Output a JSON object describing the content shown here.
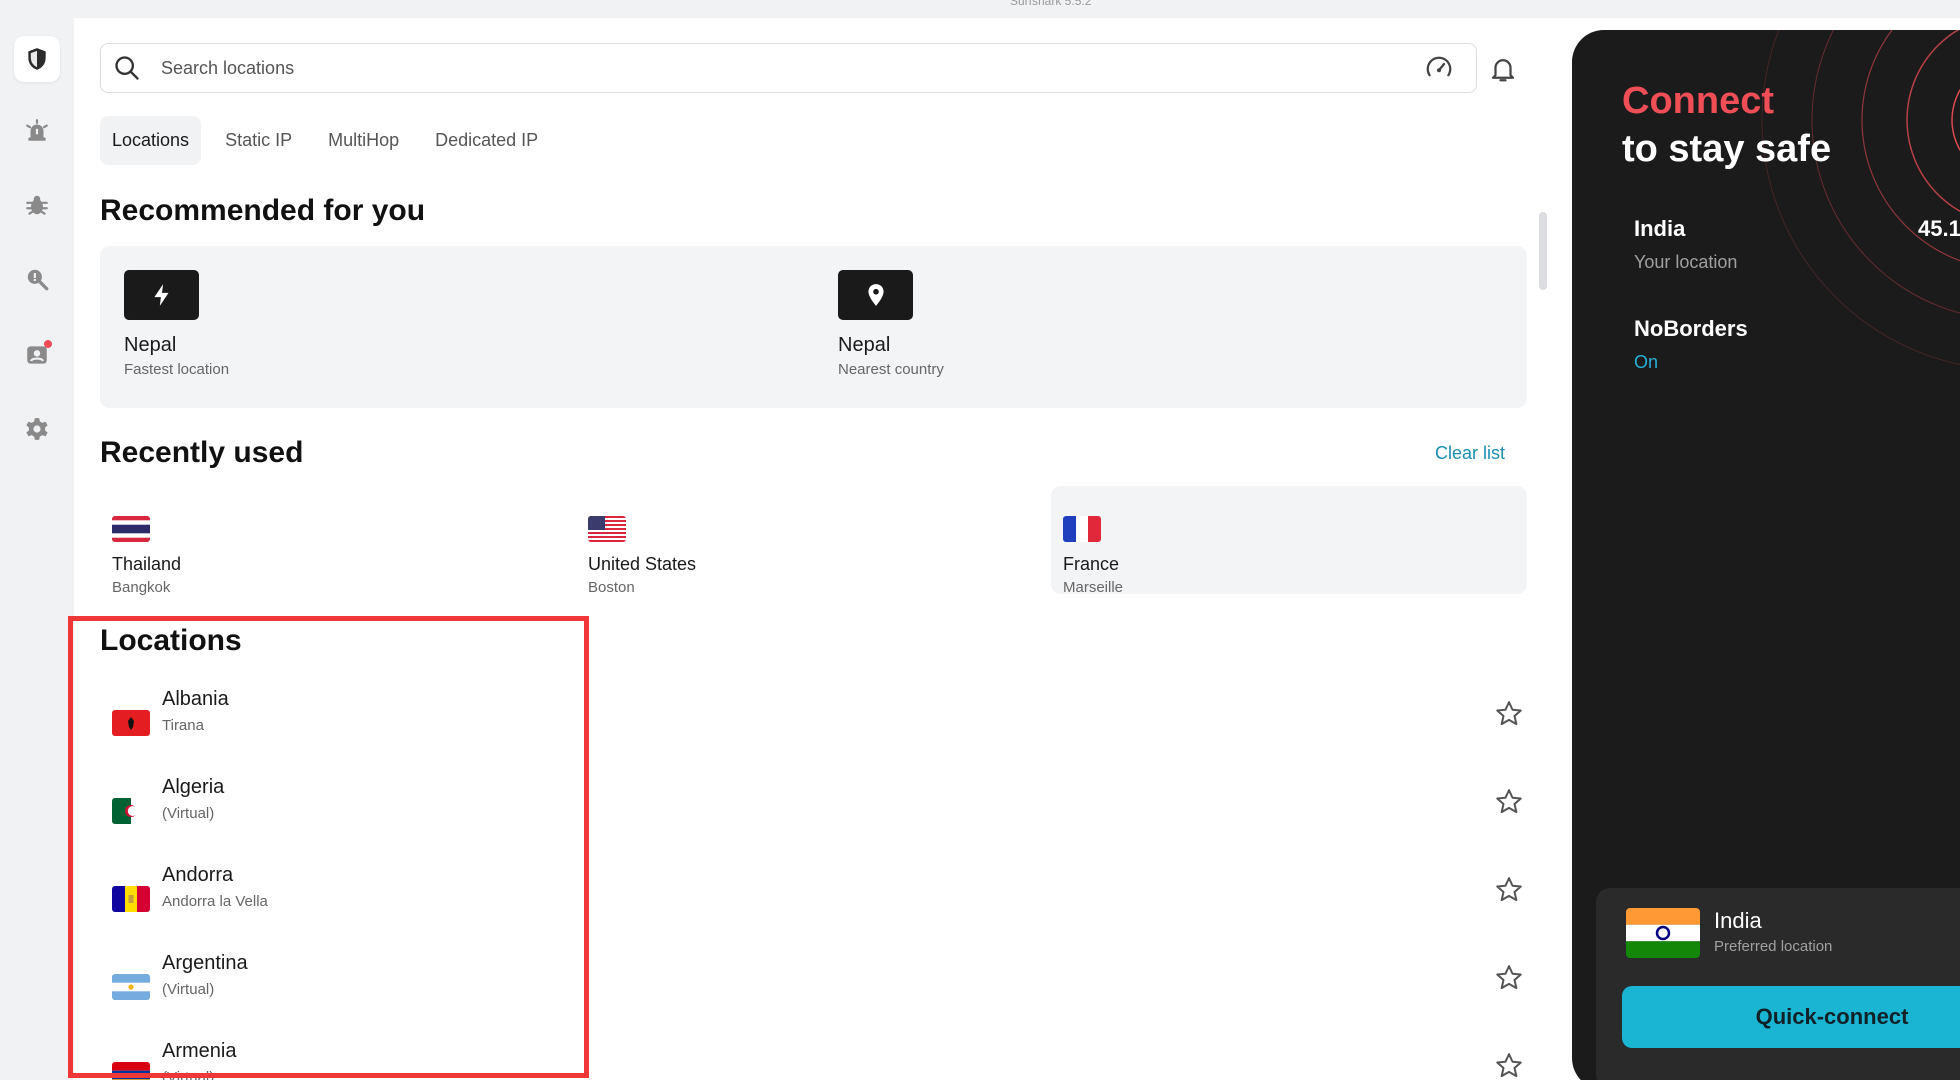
{
  "window": {
    "title": "Surfshark 5.5.2"
  },
  "sidebar": {
    "items": [
      {
        "icon": "shield-icon",
        "active": true
      },
      {
        "icon": "alert-icon",
        "active": false
      },
      {
        "icon": "bug-icon",
        "active": false
      },
      {
        "icon": "search-alert-icon",
        "active": false
      },
      {
        "icon": "contact-icon",
        "active": false,
        "notification": true
      },
      {
        "icon": "gear-icon",
        "active": false
      }
    ]
  },
  "search": {
    "placeholder": "Search locations"
  },
  "tabs": [
    {
      "label": "Locations",
      "active": true
    },
    {
      "label": "Static IP",
      "active": false
    },
    {
      "label": "MultiHop",
      "active": false
    },
    {
      "label": "Dedicated IP",
      "active": false
    }
  ],
  "recommended": {
    "heading": "Recommended for you",
    "items": [
      {
        "name": "Nepal",
        "sub": "Fastest location",
        "icon": "bolt-icon"
      },
      {
        "name": "Nepal",
        "sub": "Nearest country",
        "icon": "pin-icon"
      }
    ]
  },
  "recent": {
    "heading": "Recently used",
    "clear_label": "Clear list",
    "items": [
      {
        "name": "Thailand",
        "sub": "Bangkok",
        "flag": "thailand-flag-icon"
      },
      {
        "name": "United States",
        "sub": "Boston",
        "flag": "usa-flag-icon"
      },
      {
        "name": "France",
        "sub": "Marseille",
        "flag": "france-flag-icon"
      }
    ]
  },
  "locations": {
    "heading": "Locations",
    "items": [
      {
        "name": "Albania",
        "sub": "Tirana",
        "flag": "albania-flag-icon"
      },
      {
        "name": "Algeria",
        "sub": "(Virtual)",
        "flag": "algeria-flag-icon"
      },
      {
        "name": "Andorra",
        "sub": "Andorra la Vella",
        "flag": "andorra-flag-icon"
      },
      {
        "name": "Argentina",
        "sub": "(Virtual)",
        "flag": "argentina-flag-icon"
      },
      {
        "name": "Armenia",
        "sub": "(Virtual)",
        "flag": "armenia-flag-icon"
      }
    ]
  },
  "panel": {
    "title_line1": "Connect",
    "title_line2": "to stay safe",
    "location_name": "India",
    "location_sub": "Your location",
    "ip": "45.1",
    "noborders_label": "NoBorders",
    "noborders_status": "On",
    "preferred_name": "India",
    "preferred_sub": "Preferred location",
    "quick_connect_label": "Quick-connect"
  },
  "colors": {
    "accent_red": "#f04e57",
    "accent_cyan": "#1ab5d3",
    "link_blue": "#1b8eb0",
    "panel_bg": "#1b1b1b",
    "highlight_border": "#f03737"
  }
}
